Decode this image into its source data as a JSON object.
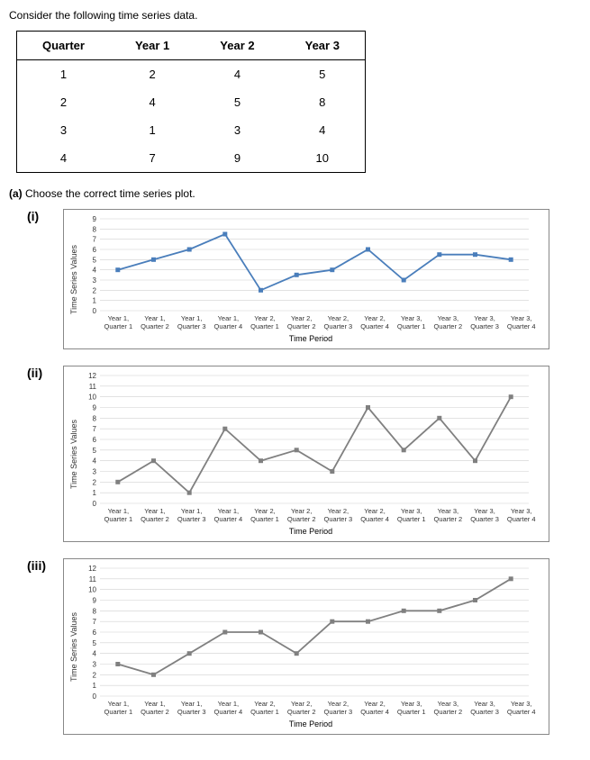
{
  "intro": "Consider the following time series data.",
  "table": {
    "headers": [
      "Quarter",
      "Year 1",
      "Year 2",
      "Year 3"
    ],
    "rows": [
      [
        "1",
        "2",
        "4",
        "5"
      ],
      [
        "2",
        "4",
        "5",
        "8"
      ],
      [
        "3",
        "1",
        "3",
        "4"
      ],
      [
        "4",
        "7",
        "9",
        "10"
      ]
    ]
  },
  "part_a_label": "(a)",
  "part_a_text": "Choose the correct time series plot.",
  "roman": {
    "i": "(i)",
    "ii": "(ii)",
    "iii": "(iii)"
  },
  "axis": {
    "y": "Time Series Values",
    "x": "Time Period"
  },
  "xticks": [
    {
      "y": "Year 1,",
      "q": "Quarter 1"
    },
    {
      "y": "Year 1,",
      "q": "Quarter 2"
    },
    {
      "y": "Year 1,",
      "q": "Quarter 3"
    },
    {
      "y": "Year 1,",
      "q": "Quarter 4"
    },
    {
      "y": "Year 2,",
      "q": "Quarter 1"
    },
    {
      "y": "Year 2,",
      "q": "Quarter 2"
    },
    {
      "y": "Year 2,",
      "q": "Quarter 3"
    },
    {
      "y": "Year 2,",
      "q": "Quarter 4"
    },
    {
      "y": "Year 3,",
      "q": "Quarter 1"
    },
    {
      "y": "Year 3,",
      "q": "Quarter 2"
    },
    {
      "y": "Year 3,",
      "q": "Quarter 3"
    },
    {
      "y": "Year 3,",
      "q": "Quarter 4"
    }
  ],
  "chart_data": [
    {
      "id": "i",
      "type": "line",
      "ylim": [
        0,
        9
      ],
      "yticks": [
        0,
        1,
        2,
        3,
        4,
        5,
        6,
        7,
        8,
        9
      ],
      "x": [
        "Y1Q1",
        "Y1Q2",
        "Y1Q3",
        "Y1Q4",
        "Y2Q1",
        "Y2Q2",
        "Y2Q3",
        "Y2Q4",
        "Y3Q1",
        "Y3Q2",
        "Y3Q3",
        "Y3Q4"
      ],
      "values": [
        4,
        5,
        6,
        7.5,
        2,
        3.5,
        4,
        6,
        3,
        5.5,
        5.5,
        5
      ],
      "color": "#4a7ebb"
    },
    {
      "id": "ii",
      "type": "line",
      "ylim": [
        0,
        12
      ],
      "yticks": [
        0,
        1,
        2,
        3,
        4,
        5,
        6,
        7,
        8,
        9,
        10,
        11,
        12
      ],
      "x": [
        "Y1Q1",
        "Y1Q2",
        "Y1Q3",
        "Y1Q4",
        "Y2Q1",
        "Y2Q2",
        "Y2Q3",
        "Y2Q4",
        "Y3Q1",
        "Y3Q2",
        "Y3Q3",
        "Y3Q4"
      ],
      "values": [
        2,
        4,
        1,
        7,
        4,
        5,
        3,
        9,
        5,
        8,
        4,
        10
      ],
      "color": "#808080"
    },
    {
      "id": "iii",
      "type": "line",
      "ylim": [
        0,
        12
      ],
      "yticks": [
        0,
        1,
        2,
        3,
        4,
        5,
        6,
        7,
        8,
        9,
        10,
        11,
        12
      ],
      "x": [
        "Y1Q1",
        "Y1Q2",
        "Y1Q3",
        "Y1Q4",
        "Y2Q1",
        "Y2Q2",
        "Y2Q3",
        "Y2Q4",
        "Y3Q1",
        "Y3Q2",
        "Y3Q3",
        "Y3Q4"
      ],
      "values": [
        3,
        2,
        4,
        6,
        6,
        4,
        7,
        7,
        8,
        8,
        9,
        11
      ],
      "color": "#808080"
    }
  ]
}
